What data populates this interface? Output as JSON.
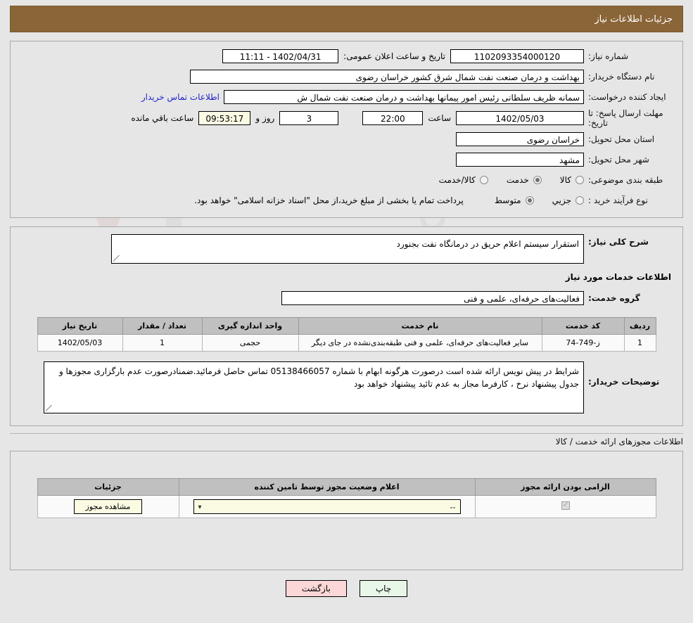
{
  "header": {
    "title": "جزئیات اطلاعات نیاز"
  },
  "summary": {
    "need_number_label": "شماره نیاز:",
    "need_number_value": "1102093354000120",
    "public_announce_label": "تاریخ و ساعت اعلان عمومی:",
    "public_announce_value": "1402/04/31 - 11:11",
    "buyer_org_label": "نام دستگاه خریدار:",
    "buyer_org_value": "بهداشت و درمان صنعت نفت شمال شرق کشور   خراسان رضوی",
    "creator_label": "ایجاد کننده درخواست:",
    "creator_value": "سمانه ظریف سلطانی رئیس امور پیمانها بهداشت و درمان صنعت نفت شمال ش",
    "buyer_contact_link": "اطلاعات تماس خریدار",
    "deadline_label": "مهلت ارسال پاسخ: تا تاریخ:",
    "deadline_date": "1402/05/03",
    "hour_label": "ساعت",
    "deadline_time": "22:00",
    "days_value": "3",
    "days_label": "روز و",
    "remaining_time": "09:53:17",
    "remaining_label": "ساعت باقي مانده",
    "province_label": "استان محل تحویل:",
    "province_value": "خراسان رضوی",
    "city_label": "شهر محل تحویل:",
    "city_value": "مشهد",
    "category_label": "طبقه بندی موضوعی:",
    "category_options": [
      {
        "label": "کالا",
        "selected": false
      },
      {
        "label": "خدمت",
        "selected": true
      },
      {
        "label": "کالا/خدمت",
        "selected": false
      }
    ],
    "process_label": "نوع فرآیند خرید :",
    "process_options": [
      {
        "label": "جزيي",
        "selected": false
      },
      {
        "label": "متوسط",
        "selected": true
      }
    ],
    "treasury_note": "پرداخت تمام یا بخشی از مبلغ خرید،از محل \"اسناد خزانه اسلامی\" خواهد بود."
  },
  "need_desc": {
    "label": "شرح کلی نیاز:",
    "value": "استقرار سیستم اعلام حریق در درمانگاه نفت بجنورد"
  },
  "services": {
    "section_title": "اطلاعات خدمات مورد نیاز",
    "group_label": "گروه خدمت:",
    "group_value": "فعالیت‌های حرفه‌ای، علمی و فنی",
    "columns": [
      "ردیف",
      "کد خدمت",
      "نام خدمت",
      "واحد اندازه گیری",
      "تعداد / مقدار",
      "تاریخ نیاز"
    ],
    "rows": [
      {
        "index": "1",
        "code": "ز-749-74",
        "name": "سایر فعالیت‌های حرفه‌ای، علمی و فنی طبقه‌بندی‌نشده در جای دیگر",
        "unit": "حجمی",
        "qty": "1",
        "date": "1402/05/03"
      }
    ]
  },
  "buyer_notes": {
    "label": "توضیحات خریدار:",
    "value": "شرایط در پیش نویس ارائه شده است درصورت هرگونه ابهام با شماره 05138466057 تماس حاصل فرمائید.ضمنادرصورت عدم بارگزاری مجوزها و جدول پیشنهاد نرخ ، کارفرما مجاز به عدم تائید پیشنهاد خواهد بود"
  },
  "licenses": {
    "section_title": "اطلاعات مجوزهای ارائه خدمت / کالا",
    "columns": [
      "الزامی بودن ارائه مجوز",
      "اعلام وضعیت مجوز توسط تامین کننده",
      "جزئیات"
    ],
    "rows": [
      {
        "required_checked": true,
        "status_value": "--",
        "details_button": "مشاهده مجوز"
      }
    ]
  },
  "footer": {
    "print_label": "چاپ",
    "back_label": "بازگشت"
  },
  "colors": {
    "header_bg": "#8a6538",
    "link": "#2222cc",
    "print_btn": "#e9f7e9",
    "back_btn": "#fbd7d7",
    "table_header": "#c0c0c0"
  }
}
